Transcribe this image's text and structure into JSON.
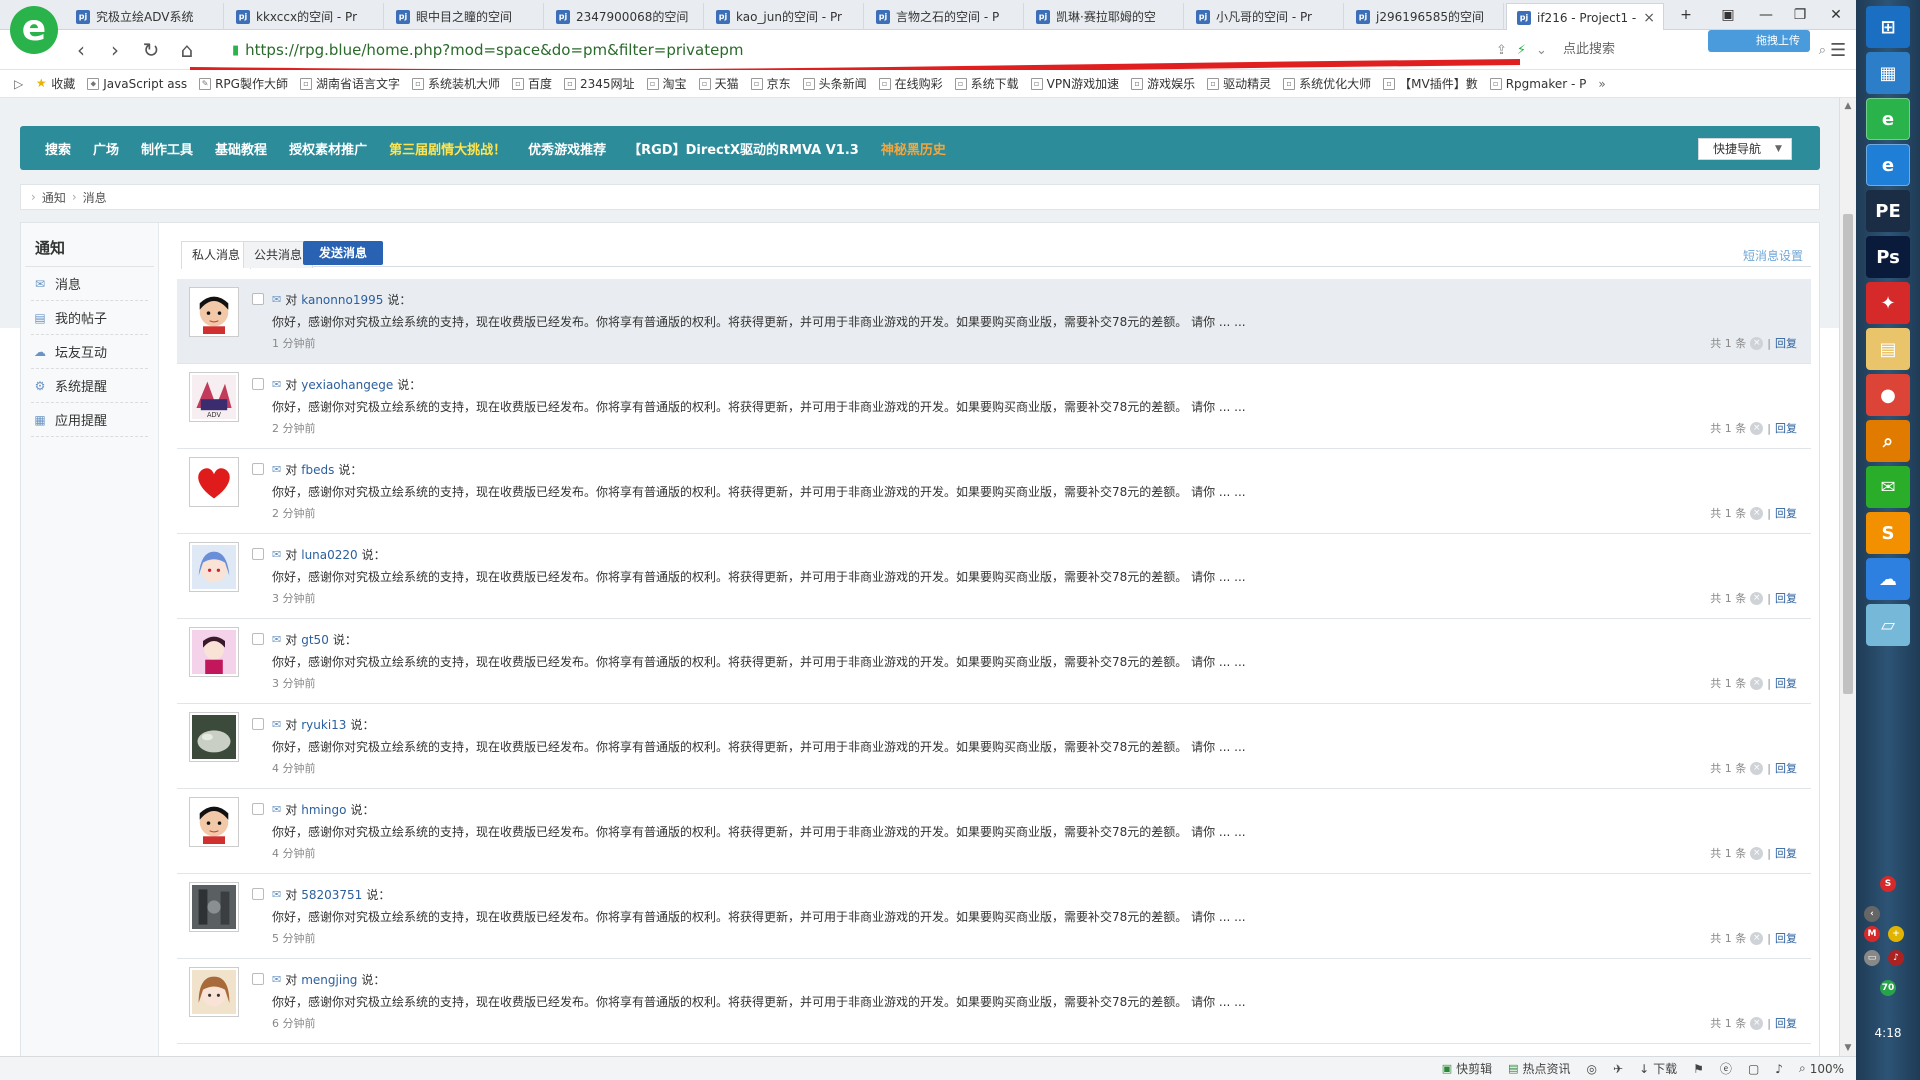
{
  "browser": {
    "tabs": [
      {
        "label": "究极立绘ADV系统"
      },
      {
        "label": "kkxccx的空间 - Pr"
      },
      {
        "label": "眼中目之瞳的空间"
      },
      {
        "label": "2347900068的空间"
      },
      {
        "label": "kao_jun的空间 - Pr"
      },
      {
        "label": "言物之石的空间 - P"
      },
      {
        "label": "凯琳·赛拉耶姆的空"
      },
      {
        "label": "小凡哥的空间 - Pr"
      },
      {
        "label": "j296196585的空间"
      },
      {
        "label": "if216 - Project1 -"
      }
    ],
    "favicon_text": "pj",
    "new_tab": "+",
    "url": "https://rpg.blue/home.php?mod=space&do=pm&filter=privatepm",
    "search_label": "点此搜索",
    "upload_label": "拖拽上传",
    "bookmarks": [
      {
        "label": "收藏",
        "icon": "star-icon"
      },
      {
        "label": "JavaScript ass",
        "icon": "js-icon"
      },
      {
        "label": "RPG製作大師",
        "icon": "rpg-icon"
      },
      {
        "label": "湖南省语言文字",
        "icon": "page-icon"
      },
      {
        "label": "系统装机大师",
        "icon": "page-icon"
      },
      {
        "label": "百度",
        "icon": "page-icon"
      },
      {
        "label": "2345网址",
        "icon": "page-icon"
      },
      {
        "label": "淘宝",
        "icon": "page-icon"
      },
      {
        "label": "天猫",
        "icon": "page-icon"
      },
      {
        "label": "京东",
        "icon": "page-icon"
      },
      {
        "label": "头条新闻",
        "icon": "page-icon"
      },
      {
        "label": "在线购彩",
        "icon": "page-icon"
      },
      {
        "label": "系统下载",
        "icon": "page-icon"
      },
      {
        "label": "VPN游戏加速",
        "icon": "page-icon"
      },
      {
        "label": "游戏娱乐",
        "icon": "page-icon"
      },
      {
        "label": "驱动精灵",
        "icon": "page-icon"
      },
      {
        "label": "系统优化大师",
        "icon": "page-icon"
      },
      {
        "label": "【MV插件】數",
        "icon": "page-icon"
      },
      {
        "label": "Rpgmaker - P",
        "icon": "page-icon"
      }
    ],
    "bookmarks_more": "»",
    "status": {
      "items": [
        {
          "label": "快剪辑"
        },
        {
          "label": "热点资讯"
        },
        {
          "label": "下载"
        }
      ],
      "zoom": "100%"
    }
  },
  "site": {
    "nav": [
      {
        "label": "搜索",
        "style": ""
      },
      {
        "label": "广场",
        "style": ""
      },
      {
        "label": "制作工具",
        "style": ""
      },
      {
        "label": "基础教程",
        "style": ""
      },
      {
        "label": "授权素材推广",
        "style": ""
      },
      {
        "label": "第三届剧情大挑战！",
        "style": "hl"
      },
      {
        "label": "优秀游戏推荐",
        "style": ""
      },
      {
        "label": "【RGD】DirectX驱动的RMVA V1.3",
        "style": ""
      },
      {
        "label": "神秘黑历史",
        "style": "or"
      }
    ],
    "quicknav": "快捷导航",
    "breadcrumb": [
      "通知",
      "消息"
    ]
  },
  "sidebar": {
    "title": "通知",
    "items": [
      {
        "label": "消息",
        "icon": "mail-icon"
      },
      {
        "label": "我的帖子",
        "icon": "doc-icon"
      },
      {
        "label": "坛友互动",
        "icon": "people-icon"
      },
      {
        "label": "系统提醒",
        "icon": "gear-icon"
      },
      {
        "label": "应用提醒",
        "icon": "grid-icon"
      }
    ]
  },
  "tabs": {
    "private": "私人消息",
    "public": "公共消息",
    "send": "发送消息",
    "settings": "短消息设置"
  },
  "messages": [
    {
      "user": "kanonno1995",
      "time": "1 分钟前",
      "face": "boy"
    },
    {
      "user": "yexiaohangege",
      "time": "2 分钟前",
      "face": "anime"
    },
    {
      "user": "fbeds",
      "time": "2 分钟前",
      "face": "heart"
    },
    {
      "user": "luna0220",
      "time": "3 分钟前",
      "face": "bluehair"
    },
    {
      "user": "gt50",
      "time": "3 分钟前",
      "face": "pink"
    },
    {
      "user": "ryuki13",
      "time": "4 分钟前",
      "face": "rock"
    },
    {
      "user": "hmingo",
      "time": "4 分钟前",
      "face": "boy"
    },
    {
      "user": "58203751",
      "time": "5 分钟前",
      "face": "dark"
    },
    {
      "user": "mengjing",
      "time": "6 分钟前",
      "face": "brown"
    }
  ],
  "message_common": {
    "prefix": "对",
    "suffix": "说：",
    "body": "你好，感谢你对究极立绘系统的支持，现在收费版已经发布。你将享有普通版的权利。将获得更新，并可用于非商业游戏的开发。如果要购买商业版，需要补交78元的差额。 请你 ... ...",
    "count": "共 1 条",
    "reply": "回复"
  },
  "taskbar": {
    "clock": "4:18",
    "badge": "70",
    "icons": [
      {
        "name": "windows-start-icon"
      },
      {
        "name": "app-grid-icon"
      },
      {
        "name": "browser-360-icon"
      },
      {
        "name": "ie-icon"
      },
      {
        "name": "pe-icon"
      },
      {
        "name": "photoshop-icon"
      },
      {
        "name": "app-red-icon"
      },
      {
        "name": "explorer-icon"
      },
      {
        "name": "chrome-icon"
      },
      {
        "name": "search-tool-icon"
      },
      {
        "name": "wechat-icon"
      },
      {
        "name": "sublime-icon"
      },
      {
        "name": "baidu-netdisk-icon"
      },
      {
        "name": "notepad-icon"
      }
    ]
  },
  "colors": {
    "site_nav_bg": "#2c8c9a",
    "highlight_yellow": "#ffe44d",
    "highlight_orange": "#f7a53b",
    "send_button": "#2a62b3",
    "link_blue": "#2b5f9e"
  }
}
